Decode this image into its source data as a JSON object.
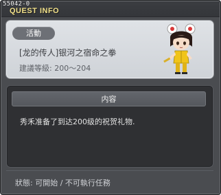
{
  "window": {
    "quest_id": "55042-0",
    "title": "QUEST INFO"
  },
  "quest": {
    "badge": "活動",
    "name": "[龙的传人]银河之宿命之拳",
    "level_range": "建議等級: 200～204"
  },
  "content": {
    "header": "内容",
    "text": "秀禾准备了到达200级的祝贺礼物."
  },
  "status": {
    "text": "狀態: 可開始 / 不可執行任務"
  },
  "colors": {
    "title_text": "#f2e18a",
    "window_bg": "#4a4c50",
    "info_panel_bg": "#d7dadf",
    "content_panel_bg": "#2f3033",
    "header_bg": "#5b5e63"
  },
  "icons": {
    "close": "close-icon",
    "avatar": "character-avatar"
  }
}
